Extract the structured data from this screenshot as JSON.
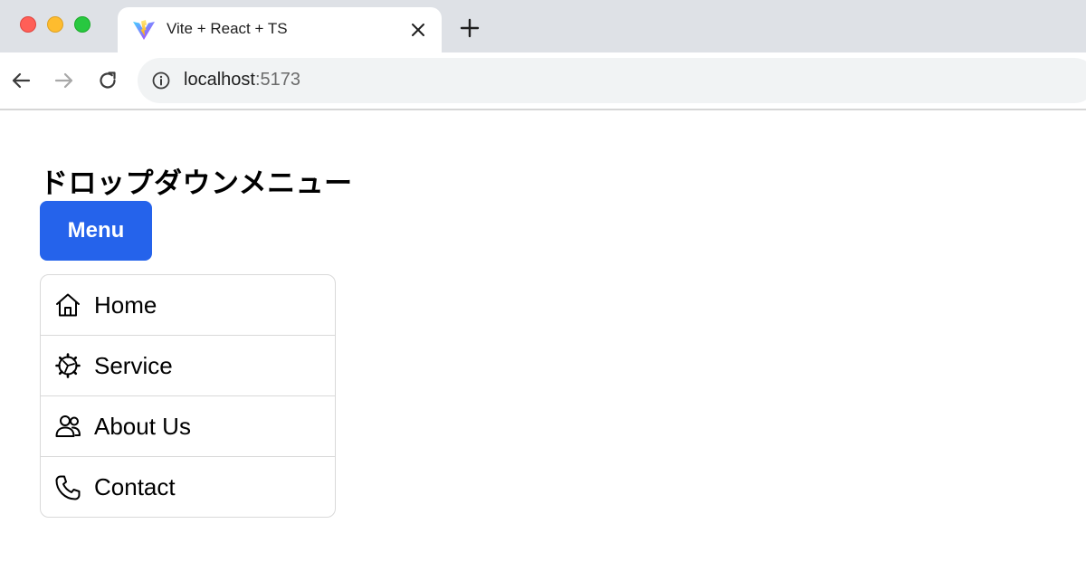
{
  "browser": {
    "tab": {
      "title": "Vite + React + TS",
      "favicon": "vite-logo-icon"
    },
    "address_bar": {
      "host": "localhost",
      "port": ":5173"
    },
    "icons": {
      "back": "arrow-left-icon",
      "forward": "arrow-right-icon",
      "reload": "reload-icon",
      "info": "info-icon",
      "close_tab": "close-icon",
      "new_tab": "plus-icon"
    }
  },
  "page": {
    "title": "ドロップダウンメニュー",
    "menu_button_label": "Menu",
    "menu_button_color": "#2563eb",
    "menu_items": [
      {
        "label": "Home",
        "icon": "home-icon"
      },
      {
        "label": "Service",
        "icon": "gear-icon"
      },
      {
        "label": "About Us",
        "icon": "users-icon"
      },
      {
        "label": "Contact",
        "icon": "phone-icon"
      }
    ]
  }
}
